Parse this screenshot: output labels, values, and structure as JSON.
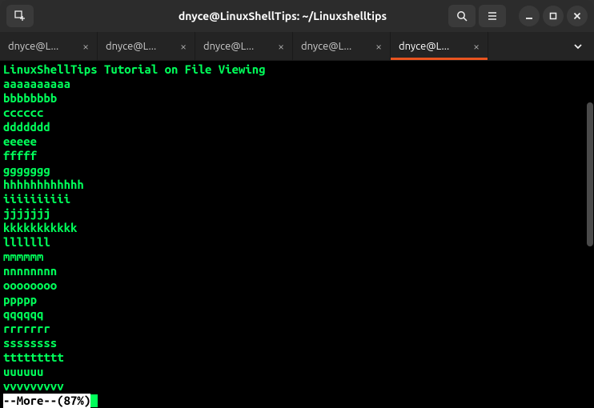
{
  "titlebar": {
    "title": "dnyce@LinuxShellTips: ~/Linuxshelltips"
  },
  "tabs": [
    {
      "label": "dnyce@L...",
      "active": false
    },
    {
      "label": "dnyce@L...",
      "active": false
    },
    {
      "label": "dnyce@L...",
      "active": false
    },
    {
      "label": "dnyce@L...",
      "active": false
    },
    {
      "label": "dnyce@L...",
      "active": true
    }
  ],
  "terminal": {
    "lines": [
      "LinuxShellTips Tutorial on File Viewing",
      "aaaaaaaaaa",
      "bbbbbbbb",
      "cccccc",
      "ddddddd",
      "eeeee",
      "fffff",
      "ggggggg",
      "hhhhhhhhhhhh",
      "iiiiiiiiii",
      "jjjjjjj",
      "kkkkkkkkkkk",
      "lllllll",
      "mmmmmm",
      "nnnnnnnn",
      "oooooooo",
      "ppppp",
      "qqqqqq",
      "rrrrrrr",
      "ssssssss",
      "ttttttttt",
      "uuuuuu",
      "vvvvvvvvv"
    ],
    "more_status": "--More--(87%)"
  }
}
